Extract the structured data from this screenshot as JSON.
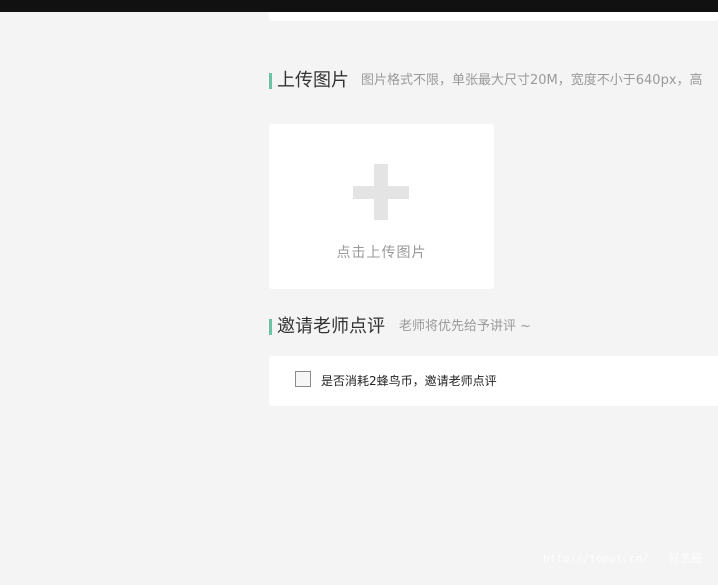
{
  "upload_section": {
    "title": "上传图片",
    "hint": "图片格式不限，单张最大尺寸20M，宽度不小于640px，高",
    "upload_label": "点击上传图片"
  },
  "invite_section": {
    "title": "邀请老师点评",
    "hint": "老师将优先给予讲评 ~",
    "checkbox_label": "是否消耗2蜂鸟币，邀请老师点评",
    "checkbox_checked": false
  },
  "watermark": {
    "text": "http://toput.cn/ · 好艺圈"
  },
  "colors": {
    "accent": "#6cc2a6",
    "background": "#f4f4f4",
    "card": "#ffffff",
    "hint_text": "#9a9a9a",
    "top_bar": "#111111"
  },
  "icons": {
    "upload": "plus-icon"
  }
}
